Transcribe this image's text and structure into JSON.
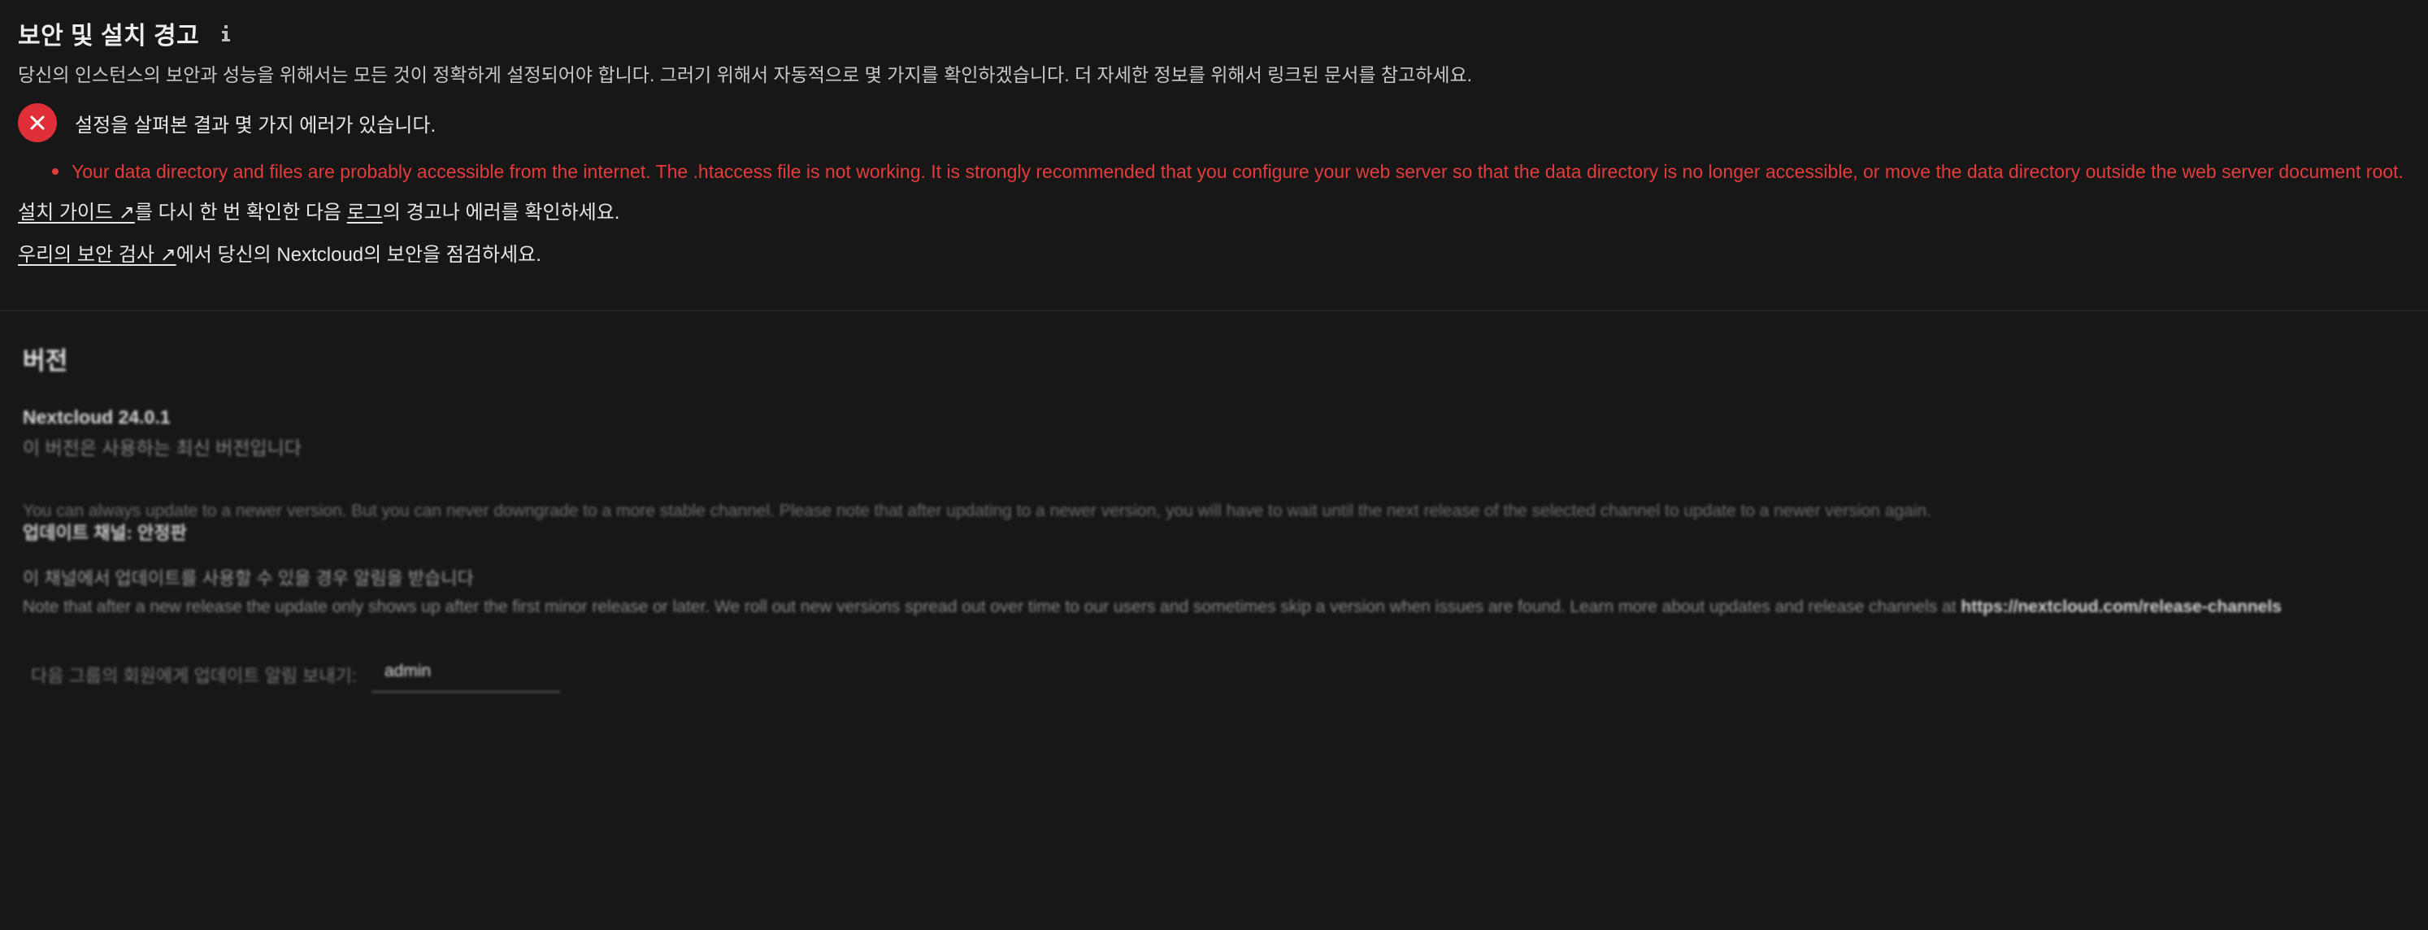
{
  "security": {
    "title": "보안 및 설치 경고",
    "info_icon": "info-icon",
    "description": "당신의 인스턴스의 보안과 성능을 위해서는 모든 것이 정확하게 설정되어야 합니다. 그러기 위해서 자동적으로 몇 가지를 확인하겠습니다. 더 자세한 정보를 위해서 링크된 문서를 참고하세요.",
    "error_icon": "close-icon",
    "error_color": "#e02f38",
    "error_summary": "설정을 살펴본 결과 몇 가지 에러가 있습니다.",
    "errors": [
      "Your data directory and files are probably accessible from the internet. The .htaccess file is not working. It is strongly recommended that you configure your web server so that the data directory is no longer accessible, or move the data directory outside the web server document root."
    ],
    "line1": {
      "link1": "설치 가이드 ↗",
      "text1": "를 다시 한 번 확인한 다음 ",
      "link2": "로그",
      "text2": "의 경고나 에러를 확인하세요."
    },
    "line2": {
      "link": "우리의 보안 검사 ↗",
      "text": "에서 당신의 Nextcloud의 보안을 점검하세요."
    }
  },
  "version": {
    "title": "버전",
    "name": "Nextcloud 24.0.1",
    "status": "이 버전은 사용하는 최신 버전입니다",
    "channel_description": "You can always update to a newer version. But you can never downgrade to a more stable channel. Please note that after updating to a newer version, you will have to wait until the next release of the selected channel to update to a newer version again.",
    "channel_label": "업데이트 채널: 안정판",
    "note": "이 채널에서 업데이트를 사용할 수 있을 경우 알림을 받습니다",
    "note2_text": "Note that after a new release the update only shows up after the first minor release or later. We roll out new versions spread out over time to our users and sometimes skip a version when issues are found. Learn more about updates and release channels at",
    "note2_url": "https://nextcloud.com/release-channels",
    "notify_label": "다음 그룹의 회원에게 업데이트 알림 보내기:",
    "notify_value": "admin"
  }
}
